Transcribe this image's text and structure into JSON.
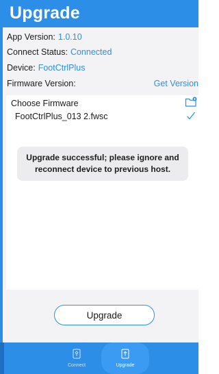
{
  "header": {
    "title": "Upgrade"
  },
  "info": {
    "app_version_label": "App Version:",
    "app_version_value": "1.0.10",
    "connect_status_label": "Connect Status:",
    "connect_status_value": "Connected",
    "device_label": "Device:",
    "device_value": "FootCtrlPlus",
    "firmware_version_label": "Firmware Version:",
    "get_version_label": "Get Version"
  },
  "firmware": {
    "choose_label": "Choose Firmware",
    "file_name": "FootCtrlPlus_013 2.fwsc",
    "folder_icon": "folder-plus-icon",
    "selected_icon": "check-icon"
  },
  "toast": {
    "line1": "Upgrade successful; please ignore and",
    "line2": "reconnect device to previous host."
  },
  "actions": {
    "upgrade_button": "Upgrade"
  },
  "tabbar": {
    "tabs": [
      {
        "label": "Connect",
        "icon": "connect-icon",
        "selected": false
      },
      {
        "label": "Upgrade",
        "icon": "upgrade-icon",
        "selected": true
      }
    ]
  },
  "colors": {
    "accent": "#2d8ee8",
    "background": "#f3f3f5",
    "panel": "#ffffff",
    "toast": "#ececee"
  }
}
